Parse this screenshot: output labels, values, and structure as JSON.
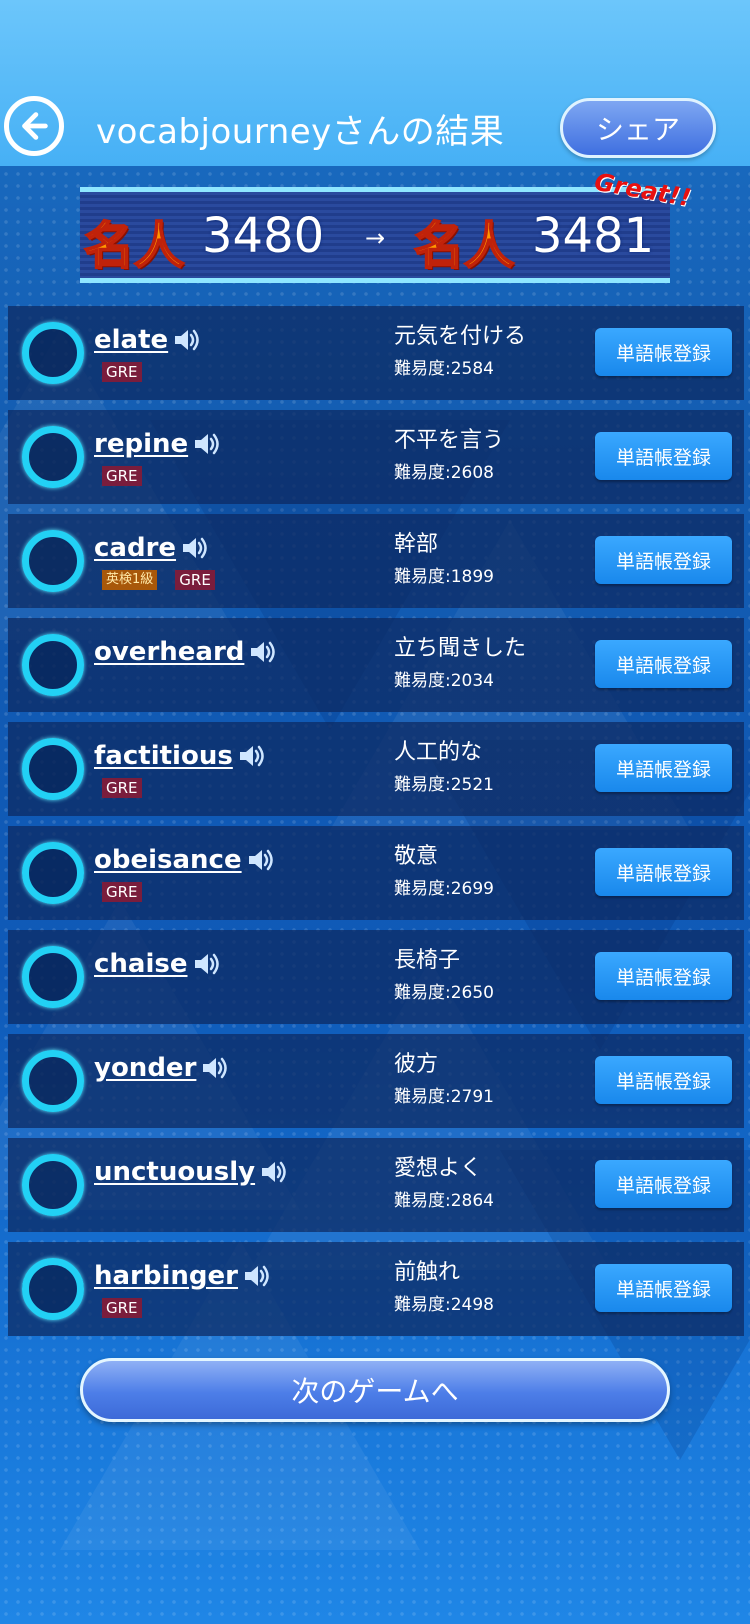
{
  "header": {
    "title": "vocabjourneyさんの結果",
    "share_label": "シェア"
  },
  "rank": {
    "before_title": "名人",
    "before_value": "3480",
    "arrow": "→",
    "after_title": "名人",
    "after_value": "3481",
    "great": "Great!!"
  },
  "words": [
    {
      "word": "elate",
      "tags": [
        "GRE"
      ],
      "meaning": "元気を付ける",
      "difficulty": "難易度:2584"
    },
    {
      "word": "repine",
      "tags": [
        "GRE"
      ],
      "meaning": "不平を言う",
      "difficulty": "難易度:2608"
    },
    {
      "word": "cadre",
      "tags": [
        "英検1級",
        "GRE"
      ],
      "meaning": "幹部",
      "difficulty": "難易度:1899"
    },
    {
      "word": "overheard",
      "tags": [],
      "meaning": "立ち聞きした",
      "difficulty": "難易度:2034"
    },
    {
      "word": "factitious",
      "tags": [
        "GRE"
      ],
      "meaning": "人工的な",
      "difficulty": "難易度:2521"
    },
    {
      "word": "obeisance",
      "tags": [
        "GRE"
      ],
      "meaning": "敬意",
      "difficulty": "難易度:2699"
    },
    {
      "word": "chaise",
      "tags": [],
      "meaning": "長椅子",
      "difficulty": "難易度:2650"
    },
    {
      "word": "yonder",
      "tags": [],
      "meaning": "彼方",
      "difficulty": "難易度:2791"
    },
    {
      "word": "unctuously",
      "tags": [],
      "meaning": "愛想よく",
      "difficulty": "難易度:2864"
    },
    {
      "word": "harbinger",
      "tags": [
        "GRE"
      ],
      "meaning": "前触れ",
      "difficulty": "難易度:2498"
    }
  ],
  "register_label": "単語帳登録",
  "next_label": "次のゲームへ",
  "colors": {
    "header": "#46b0f5",
    "accent_cyan": "#22d1f5",
    "button_blue": "#1988ec",
    "gre_tag": "#7a1d3c",
    "eiken_tag": "#a8580a",
    "rank_orange": "#ff9900"
  }
}
